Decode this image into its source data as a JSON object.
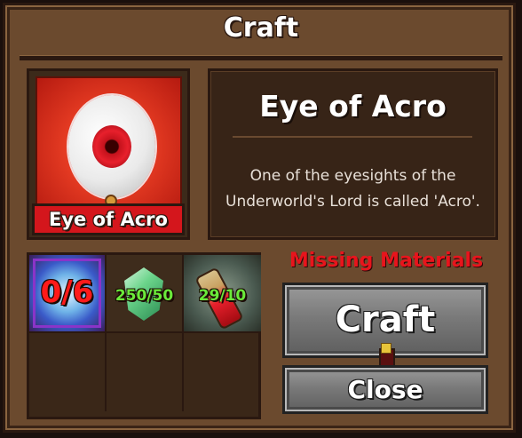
{
  "window": {
    "title": "Craft"
  },
  "item": {
    "name": "Eye of Acro",
    "label": "Eye of Acro",
    "icon": "eyeball-icon",
    "description_line1": "One of the eyesights of the",
    "description_line2": "Underworld's Lord is called 'Acro'."
  },
  "materials": [
    {
      "icon": "blue-crystal-icon",
      "count": "0/6",
      "status_color": "#ff1a1a"
    },
    {
      "icon": "emerald-gem-icon",
      "count": "250/50",
      "status_color": "#6aea3a"
    },
    {
      "icon": "red-potion-vial-icon",
      "count": "29/10",
      "status_color": "#6aea3a"
    }
  ],
  "status": {
    "missing_text": "Missing Materials",
    "color": "#e8141c"
  },
  "buttons": {
    "craft_label": "Craft",
    "close_label": "Close"
  }
}
